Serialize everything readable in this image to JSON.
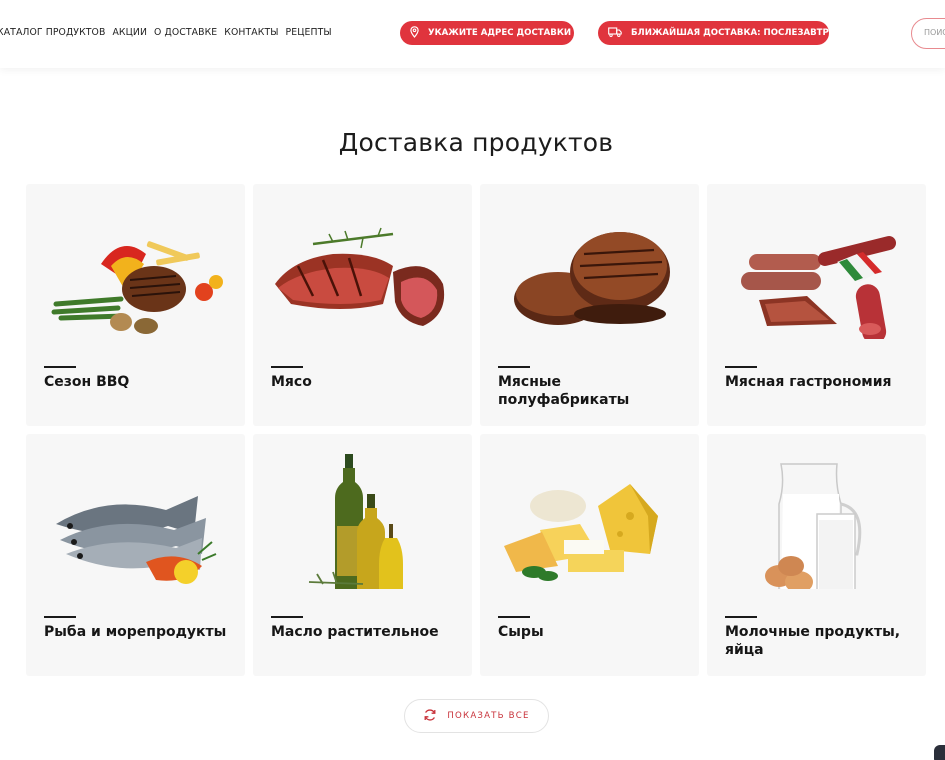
{
  "header": {
    "nav": [
      "КАТАЛОГ ПРОДУКТОВ",
      "АКЦИИ",
      "О ДОСТАВКЕ",
      "КОНТАКТЫ",
      "РЕЦЕПТЫ"
    ],
    "address_button": "УКАЖИТЕ АДРЕС ДОСТАВКИ",
    "delivery_button": "БЛИЖАЙШАЯ ДОСТАВКА: ПОСЛЕЗАВТРА",
    "search_placeholder": "ПОИС"
  },
  "main": {
    "title": "Доставка продуктов",
    "categories": [
      {
        "label": "Сезон BBQ",
        "icon": "bbq-grill-image"
      },
      {
        "label": "Мясо",
        "icon": "steak-image"
      },
      {
        "label": "Мясные полуфабрикаты",
        "icon": "patties-image"
      },
      {
        "label": "Мясная гастрономия",
        "icon": "sausages-image"
      },
      {
        "label": "Рыба и морепродукты",
        "icon": "fish-image"
      },
      {
        "label": "Масло растительное",
        "icon": "oil-bottles-image"
      },
      {
        "label": "Сыры",
        "icon": "cheese-image"
      },
      {
        "label": "Молочные продукты, яйца",
        "icon": "milk-eggs-image"
      }
    ],
    "show_all": "ПОКАЗАТЬ ВСЕ"
  },
  "colors": {
    "accent": "#e0343d",
    "card_bg": "#f7f7f7",
    "text": "#1a1a1a"
  }
}
